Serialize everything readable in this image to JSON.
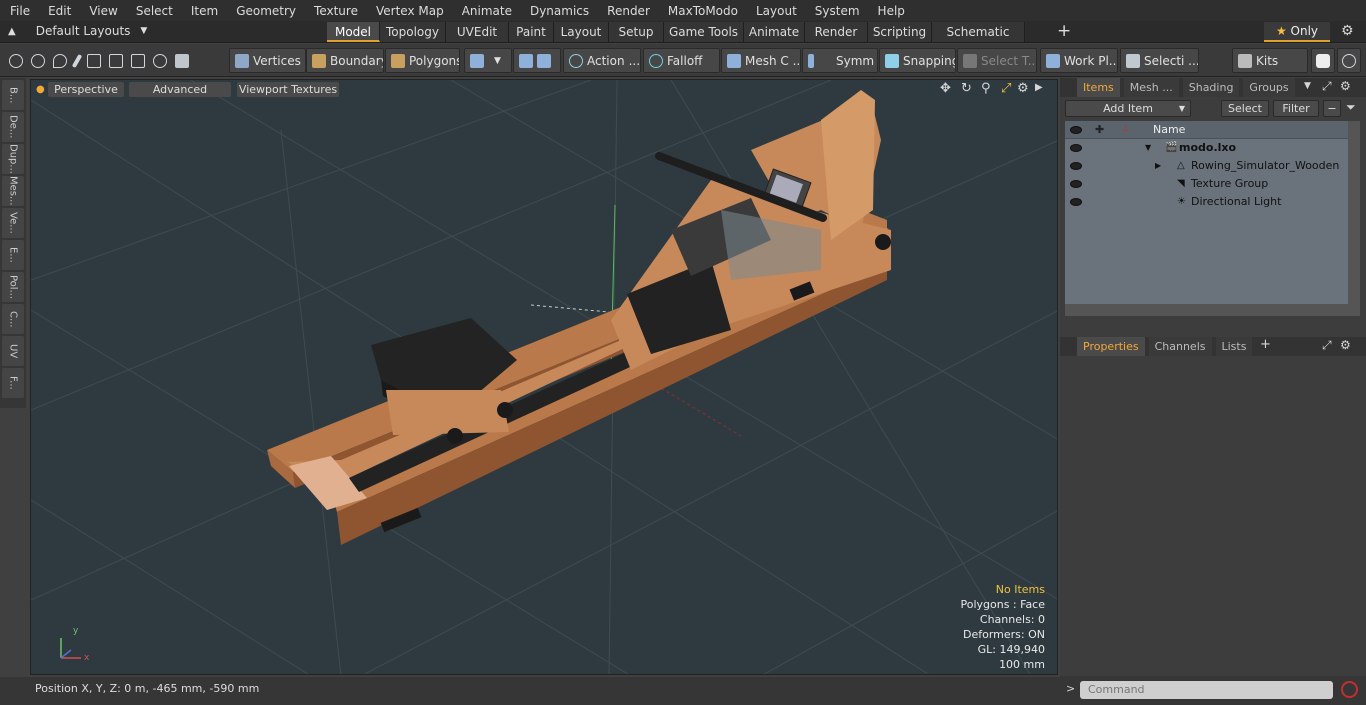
{
  "menu": [
    "File",
    "Edit",
    "View",
    "Select",
    "Item",
    "Geometry",
    "Texture",
    "Vertex Map",
    "Animate",
    "Dynamics",
    "Render",
    "MaxToModo",
    "Layout",
    "System",
    "Help"
  ],
  "layouts": {
    "label": "Default Layouts"
  },
  "tabs": [
    "Model",
    "Topology",
    "UVEdit",
    "Paint",
    "Layout",
    "Setup",
    "Game Tools",
    "Animate",
    "Render",
    "Scripting",
    "Schematic Fusion"
  ],
  "tabs_active": "Model",
  "only_label": "Only",
  "toolbar": {
    "vertices": "Vertices",
    "boundary": "Boundary",
    "polygons": "Polygons",
    "action": "Action",
    "falloff": "Falloff",
    "mesh": "Mesh C ...",
    "symm": "Symm ...",
    "snapping": "Snapping",
    "select_t": "Select T...",
    "workpl": "Work Pl...",
    "selecti": "Selecti ...",
    "kits": "Kits"
  },
  "left_tabs": [
    "B...",
    "De...",
    "Dup...",
    "Mes...",
    "Ve...",
    "E...",
    "Pol...",
    "C...",
    "UV",
    "F..."
  ],
  "viewport": {
    "perspective": "Perspective",
    "advanced": "Advanced",
    "textures": "Viewport Textures",
    "stats": {
      "no_items": "No Items",
      "polygons": "Polygons : Face",
      "channels": "Channels: 0",
      "deformers": "Deformers: ON",
      "gl": "GL: 149,940",
      "scale": "100 mm"
    }
  },
  "status": {
    "position": "Position X, Y, Z:   0 m, -465 mm, -590 mm"
  },
  "panel_tabs": [
    "Items",
    "Mesh ...",
    "Shading",
    "Groups"
  ],
  "panel_tab_active": "Items",
  "panel_buttons": {
    "add_item": "Add Item",
    "select": "Select",
    "filter": "Filter"
  },
  "items_header": {
    "name": "Name"
  },
  "items": [
    {
      "name": "modo.lxo",
      "indent": 0
    },
    {
      "name": "Rowing_Simulator_Wooden",
      "indent": 1
    },
    {
      "name": "Texture Group",
      "indent": 1
    },
    {
      "name": "Directional Light",
      "indent": 1
    }
  ],
  "props_tabs": [
    "Properties",
    "Channels",
    "Lists"
  ],
  "props_active": "Properties",
  "command": {
    "placeholder": "Command"
  },
  "colors": {
    "accent": "#f2a838",
    "viewport": "#2e3a40",
    "wood": "#c8895a"
  }
}
